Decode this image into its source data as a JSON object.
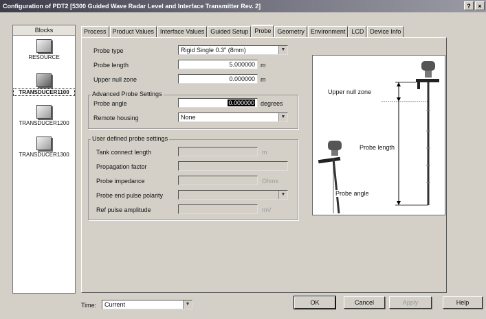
{
  "window": {
    "title": "Configuration of PDT2 [5300 Guided Wave Radar Level and Interface Transmitter Rev. 2]",
    "help_btn": "?",
    "close_btn": "×"
  },
  "blocks": {
    "header": "Blocks",
    "items": [
      {
        "label": "RESOURCE"
      },
      {
        "label": "TRANSDUCER1100"
      },
      {
        "label": "TRANSDUCER1200"
      },
      {
        "label": "TRANSDUCER1300"
      }
    ]
  },
  "tabs": [
    "Process",
    "Product Values",
    "Interface Values",
    "Guided Setup",
    "Probe",
    "Geometry",
    "Environment",
    "LCD",
    "Device Info"
  ],
  "active_tab": "Probe",
  "probe": {
    "probe_type_label": "Probe type",
    "probe_type_value": "Rigid Single 0.3\" (8mm)",
    "probe_length_label": "Probe length",
    "probe_length_value": "5.000000",
    "probe_length_unit": "m",
    "upper_null_label": "Upper null zone",
    "upper_null_value": "0.000000",
    "upper_null_unit": "m",
    "advanced_label": "Advanced Probe Settings",
    "probe_angle_label": "Probe angle",
    "probe_angle_value": "0.000000",
    "probe_angle_unit": "degrees",
    "remote_housing_label": "Remote housing",
    "remote_housing_value": "None",
    "user_defined_label": "User defined probe settings",
    "tank_connect_label": "Tank connect length",
    "tank_connect_unit": "m",
    "propagation_label": "Propagation factor",
    "impedance_label": "Probe impedance",
    "impedance_unit": "Ohms",
    "end_pulse_label": "Probe end pulse polarity",
    "ref_pulse_label": "Ref pulse amplitude",
    "ref_pulse_unit": "mV"
  },
  "diagram": {
    "upper_null_zone": "Upper null zone",
    "probe_length": "Probe length",
    "probe_angle": "Probe angle"
  },
  "footer": {
    "time_label": "Time:",
    "time_value": "Current",
    "ok": "OK",
    "cancel": "Cancel",
    "apply": "Apply",
    "help": "Help"
  }
}
